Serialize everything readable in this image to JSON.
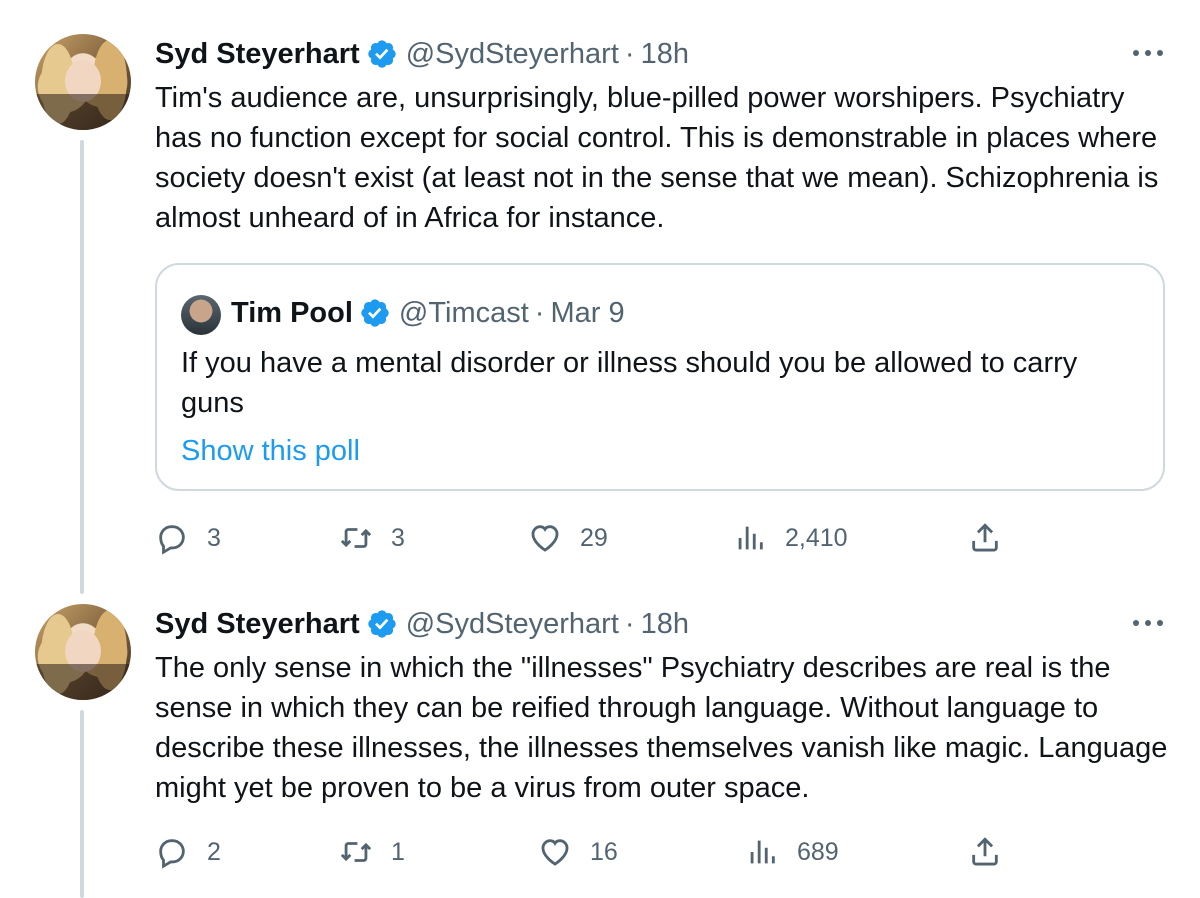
{
  "colors": {
    "text": "#0f1419",
    "secondary": "#536471",
    "link": "#1d9bf0",
    "verified": "#1d9bf0",
    "border": "#cfd9de"
  },
  "tweets": [
    {
      "name": "Syd Steyerhart",
      "handle": "@SydSteyerhart",
      "separator": "·",
      "time": "18h",
      "text": "Tim's audience are, unsurprisingly, blue-pilled power worshipers. Psychiatry has no function except for social control. This is demonstrable in places where society doesn't exist (at least not in the sense that we mean). Schizophrenia is almost unheard of in Africa for instance.",
      "quote": {
        "name": "Tim Pool",
        "handle": "@Timcast",
        "separator": "·",
        "time": "Mar 9",
        "text": "If you have a mental disorder or illness should you be allowed to carry guns",
        "link": "Show this poll"
      },
      "actions": {
        "replies": "3",
        "retweets": "3",
        "likes": "29",
        "views": "2,410"
      }
    },
    {
      "name": "Syd Steyerhart",
      "handle": "@SydSteyerhart",
      "separator": "·",
      "time": "18h",
      "text": "The only sense in which the \"illnesses\" Psychiatry describes are real is the sense in which they can be reified through language. Without language to describe these illnesses, the illnesses themselves vanish like magic. Language might yet be proven to be a virus from outer space.",
      "actions": {
        "replies": "2",
        "retweets": "1",
        "likes": "16",
        "views": "689"
      }
    }
  ],
  "icons": {
    "verified": "verified-badge-icon",
    "more": "more-options-icon",
    "reply": "reply-icon",
    "retweet": "retweet-icon",
    "like": "heart-icon",
    "views": "views-icon",
    "share": "share-icon"
  }
}
